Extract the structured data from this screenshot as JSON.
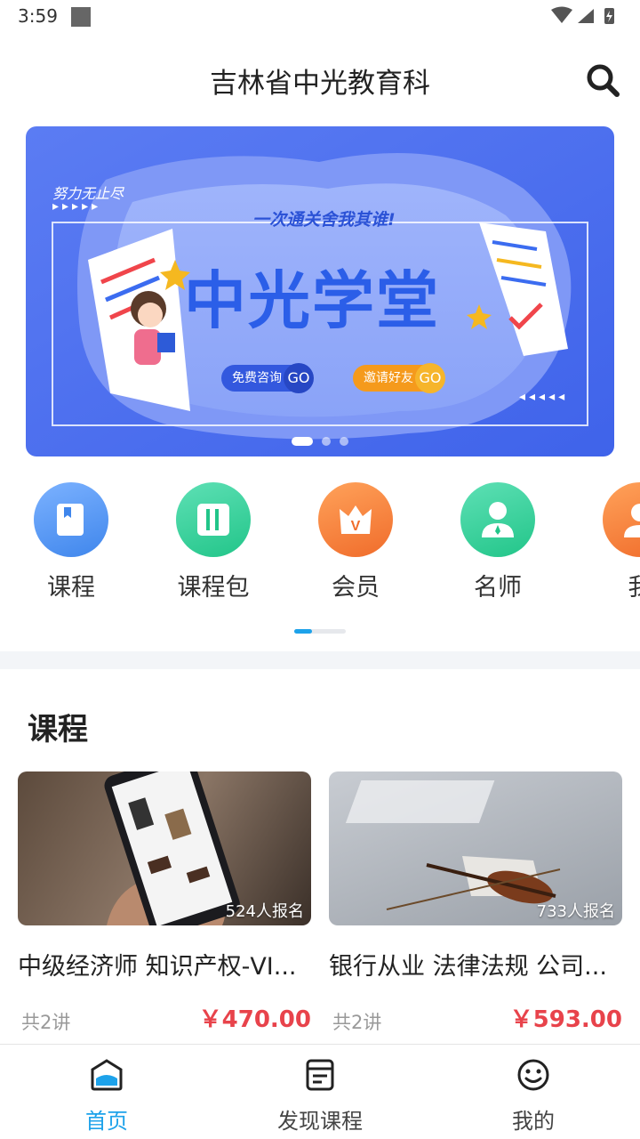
{
  "status_bar": {
    "time": "3:59"
  },
  "header": {
    "title": "吉林省中光教育科"
  },
  "banner": {
    "slogan_left": "努力无止尽",
    "subtitle": "一次通关舍我其谁!",
    "title": "中光学堂",
    "btn_consult": "免费咨询",
    "btn_invite": "邀请好友",
    "go": "GO",
    "page_count": 3,
    "active_page": 1
  },
  "categories": [
    {
      "label": "课程",
      "icon": "book-icon",
      "color": "#4a8cf0"
    },
    {
      "label": "课程包",
      "icon": "book-open-icon",
      "color": "#2ccf95"
    },
    {
      "label": "会员",
      "icon": "vip-icon",
      "color": "#f6893a"
    },
    {
      "label": "名师",
      "icon": "teacher-icon",
      "color": "#2ccf95"
    },
    {
      "label": "我",
      "icon": "user-icon",
      "color": "#f6893a"
    }
  ],
  "section": {
    "title": "课程"
  },
  "courses": [
    {
      "enroll": "524人报名",
      "title": "中级经济师 知识产权-VI...",
      "lessons": "共2讲",
      "price": "￥470.00"
    },
    {
      "enroll": "733人报名",
      "title": "银行从业 法律法规 公司...",
      "lessons": "共2讲",
      "price": "￥593.00"
    }
  ],
  "nav": [
    {
      "label": "首页",
      "icon": "home-icon",
      "active": true
    },
    {
      "label": "发现课程",
      "icon": "discover-icon",
      "active": false
    },
    {
      "label": "我的",
      "icon": "smile-icon",
      "active": false
    }
  ],
  "colors": {
    "accent": "#1da2ea",
    "price": "#e8434b",
    "banner": "#4a6cf0"
  }
}
